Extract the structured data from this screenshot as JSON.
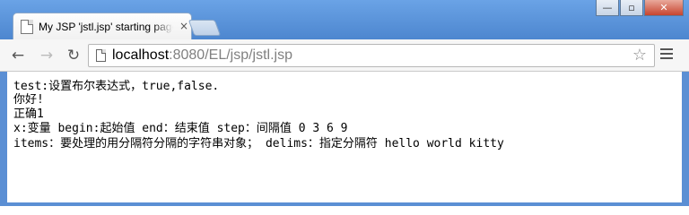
{
  "browser": {
    "tab_title": "My JSP 'jstl.jsp' starting page",
    "tab_close": "×",
    "window_buttons": {
      "minimize": "—",
      "maximize": "▫",
      "close": "✕"
    },
    "nav": {
      "back": "←",
      "forward": "→",
      "reload": "↻"
    },
    "address": {
      "host": "localhost",
      "rest": ":8080/EL/jsp/jstl.jsp"
    },
    "star": "☆"
  },
  "page": {
    "lines": [
      "test:设置布尔表达式，true,false.",
      "你好!",
      "正确1",
      "x:变量 begin:起始值 end：结束值 step：间隔值 0 3 6 9",
      "items：要处理的用分隔符分隔的字符串对象； delims：指定分隔符 hello world kitty"
    ]
  },
  "colors": {
    "frame": "#5b8fd4",
    "tab_bg": "#f5f5f5",
    "url_rest": "#808080"
  }
}
